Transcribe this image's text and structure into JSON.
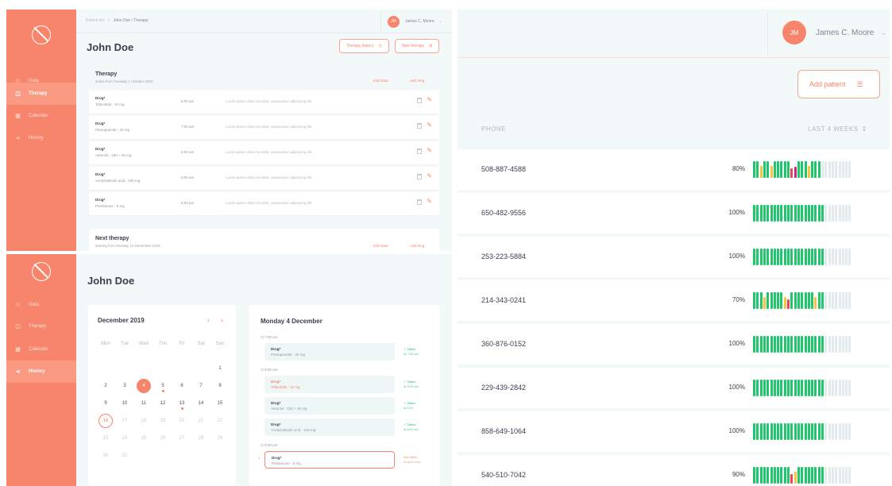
{
  "colors": {
    "accent": "#f7856b",
    "green": "#1fc66b",
    "yellow": "#f4c63d",
    "red": "#f0405a",
    "empty": "#e4ebee"
  },
  "panel1": {
    "sidebar": {
      "items": [
        {
          "label": "Data",
          "icon": "user-icon"
        },
        {
          "label": "Therapy",
          "icon": "pill-icon",
          "active": true
        },
        {
          "label": "Calendar",
          "icon": "calendar-icon"
        },
        {
          "label": "History",
          "icon": "history-icon"
        }
      ]
    },
    "breadcrumb": {
      "root": "Patient list",
      "sep": ">",
      "current": "John Doe / Therapy"
    },
    "user": {
      "initials": "JM",
      "name": "James C. Moore"
    },
    "title": "John Doe",
    "buttons": {
      "history": "Therapy history",
      "new": "New therapy"
    },
    "therapy": {
      "title": "Therapy",
      "subtitle": "active from Tuesday 1 October 2019",
      "edit": "Edit state",
      "add": "Add drug"
    },
    "drugs": [
      {
        "name": "Drug*",
        "dose": "Tofacitinib - 10 mg",
        "time": "8:00 am",
        "note": "Lorem ipsum dolor sit amet, consectetur adipiscing elit."
      },
      {
        "name": "Drug*",
        "dose": "Pantoprazole - 20 mg",
        "time": "7:00 am",
        "note": "Lorem ipsum dolor sit amet, consectetur adipiscing elit."
      },
      {
        "name": "Drug*",
        "dose": "Atenolol - 100 + 25 mg",
        "time": "8:00 am",
        "note": "Lorem ipsum dolor sit amet, consectetur adipiscing elit."
      },
      {
        "name": "Drug*",
        "dose": "Acetylsalicylic acid - 100 mg",
        "time": "8:00 am",
        "note": "Lorem ipsum dolor sit amet, consectetur adipiscing elit."
      },
      {
        "name": "Drug*",
        "dose": "Prednisone - 5 mg",
        "time": "8:00 pm",
        "note": "Lorem ipsum dolor sit amet, consectetur adipiscing elit."
      }
    ],
    "next": {
      "title": "Next therapy",
      "subtitle": "starting from Monday 16 December 2019",
      "edit": "Edit state",
      "add": "Add drug"
    }
  },
  "panel2": {
    "sidebar": {
      "items": [
        {
          "label": "Data",
          "icon": "user-icon"
        },
        {
          "label": "Therapy",
          "icon": "pill-icon"
        },
        {
          "label": "Calendar",
          "icon": "calendar-icon"
        },
        {
          "label": "History",
          "icon": "history-icon",
          "active": true
        }
      ]
    },
    "title": "John Doe",
    "calendar": {
      "month": "December 2019",
      "weekdays": [
        "Mon",
        "Tue",
        "Wed",
        "Thu",
        "Fri",
        "Sat",
        "Sun"
      ],
      "days": [
        "1",
        "2",
        "3",
        "4",
        "5",
        "6",
        "7",
        "8",
        "9",
        "10",
        "11",
        "12",
        "13",
        "14",
        "15",
        "16",
        "17",
        "18",
        "19",
        "20",
        "21",
        "22",
        "23",
        "24",
        "25",
        "26",
        "27",
        "28",
        "29",
        "30",
        "31"
      ],
      "today": "4",
      "selected": "16"
    },
    "day": {
      "title": "Monday 4 December",
      "slots": [
        {
          "time": "7:00 am",
          "events": [
            {
              "name": "Drug*",
              "dose": "Pantoprazole - 20 mg",
              "status": "✓ Taken",
              "stime": "at 7:00 am"
            }
          ]
        },
        {
          "time": "8:00 am",
          "events": [
            {
              "name": "Drug*",
              "dose": "Tofacitinib - 10 mg",
              "status": "✓ Taken",
              "stime": "at 8:00 am",
              "red": true
            },
            {
              "name": "Drug*",
              "dose": "Atenolol - 100 + 25 mg",
              "status": "✓ Taken",
              "stime": "at 8:01"
            },
            {
              "name": "Drug*",
              "dose": "Acetylsalicylic acid - 100 mg",
              "status": "✓ Taken",
              "stime": "at 8:00 am"
            }
          ]
        },
        {
          "time": "8:00 pm",
          "events": [
            {
              "name": "Drug*",
              "dose": "Prednisone - 5 mg",
              "status": "Not taken",
              "stime": "forgot/refuse",
              "notTaken": true
            }
          ]
        }
      ]
    }
  },
  "panel3": {
    "user": {
      "initials": "JM",
      "name": "James C. Moore"
    },
    "add_button": "Add patient",
    "headers": {
      "phone": "PHONE",
      "weeks": "LAST 4 WEEKS"
    },
    "patients": [
      {
        "phone": "508-887-4588",
        "percent": "80%",
        "bars": "ggyggygggggrpgggyggg.........",
        "slots": 29
      },
      {
        "phone": "650-482-9556",
        "percent": "100%",
        "bars": "ggggggggggggggggggggg........"
      },
      {
        "phone": "253-223-5884",
        "percent": "100%",
        "bars": "ggggggggggggggggggggg........"
      },
      {
        "phone": "214-343-0241",
        "percent": "70%",
        "bars": "gggygggggyrgggggggygg........"
      },
      {
        "phone": "360-876-0152",
        "percent": "100%",
        "bars": "ggggggggggggggggggggg........"
      },
      {
        "phone": "229-439-2842",
        "percent": "100%",
        "bars": "ggggggggggggggggggggg........"
      },
      {
        "phone": "858-649-1064",
        "percent": "100%",
        "bars": "ggggggggggggggggggggg........"
      },
      {
        "phone": "540-510-7042",
        "percent": "90%",
        "bars": "gggggggggggrygggggggg........"
      }
    ]
  }
}
